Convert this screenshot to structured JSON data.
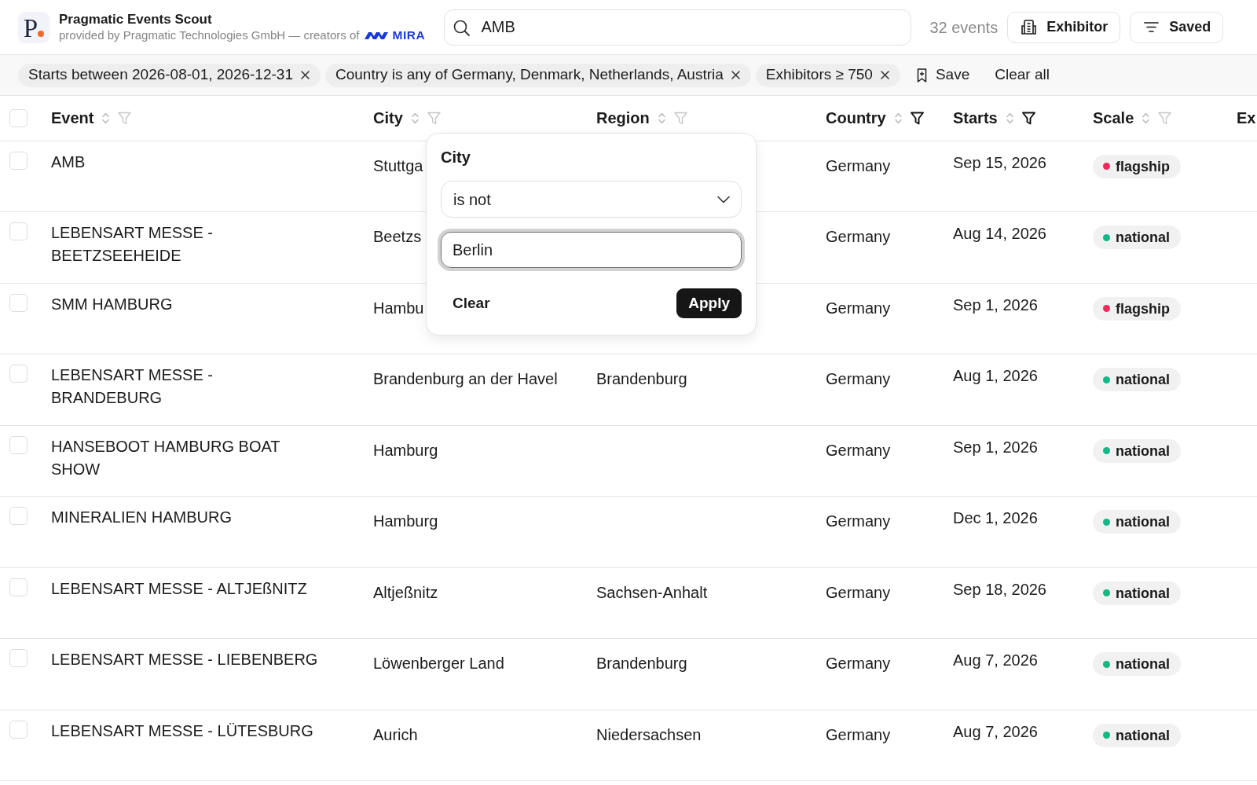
{
  "header": {
    "logo_letter": "P",
    "title": "Pragmatic Events Scout",
    "subtitle": "provided by Pragmatic Technologies GmbH — creators of",
    "brand": "MIRA",
    "search": {
      "value": "AMB"
    },
    "count": "32 events",
    "buttons": [
      {
        "label": "Exhibitor",
        "kind": "exhibitor"
      },
      {
        "label": "Saved",
        "kind": "saved"
      }
    ]
  },
  "filters": {
    "chips": [
      {
        "label": "Starts between 2026-08-01, 2026-12-31"
      },
      {
        "label": "Country is any of Germany, Denmark, Netherlands, Austria"
      },
      {
        "label": "Exhibitors ≥ 750"
      }
    ],
    "save": "Save",
    "clear_all": "Clear all"
  },
  "table": {
    "all_selected": false,
    "columns": [
      {
        "label": "Event",
        "filtered": false
      },
      {
        "label": "City",
        "filtered": false
      },
      {
        "label": "Region",
        "filtered": false
      },
      {
        "label": "Country",
        "filtered": true
      },
      {
        "label": "Starts",
        "filtered": true
      },
      {
        "label": "Scale",
        "filtered": false
      }
    ],
    "cut_column": {
      "label": "Ex"
    },
    "rows": [
      {
        "selected": false,
        "event": "AMB",
        "city": "Stuttga",
        "country": "Germany",
        "starts": "Sep 15, 2026",
        "scale": {
          "label": "flagship",
          "color": "#f2295b"
        }
      },
      {
        "selected": false,
        "event": "LEBENSART MESSE - BEETZSEEHEIDE",
        "city": "Beetzs",
        "country": "Germany",
        "starts": "Aug 14, 2026",
        "scale": {
          "label": "national",
          "color": "#12b886"
        }
      },
      {
        "selected": false,
        "event": "SMM HAMBURG",
        "city": "Hambu",
        "country": "Germany",
        "starts": "Sep 1, 2026",
        "scale": {
          "label": "flagship",
          "color": "#f2295b"
        }
      },
      {
        "selected": false,
        "event": "LEBENSART MESSE - BRANDEBURG",
        "city": "Brandenburg an der Havel",
        "region": "Brandenburg",
        "country": "Germany",
        "starts": "Aug 1, 2026",
        "scale": {
          "label": "national",
          "color": "#12b886"
        }
      },
      {
        "selected": false,
        "event": "HANSEBOOT HAMBURG BOAT SHOW",
        "city": "Hamburg",
        "country": "Germany",
        "starts": "Sep 1, 2026",
        "scale": {
          "label": "national",
          "color": "#12b886"
        }
      },
      {
        "selected": false,
        "event": "MINERALIEN HAMBURG",
        "city": "Hamburg",
        "country": "Germany",
        "starts": "Dec 1, 2026",
        "scale": {
          "label": "national",
          "color": "#12b886"
        }
      },
      {
        "selected": false,
        "event": "LEBENSART MESSE - ALTJEßNITZ",
        "city": "Altjeßnitz",
        "region": "Sachsen-Anhalt",
        "country": "Germany",
        "starts": "Sep 18, 2026",
        "scale": {
          "label": "national",
          "color": "#12b886"
        }
      },
      {
        "selected": false,
        "event": "LEBENSART MESSE - LIEBENBERG",
        "city": "Löwenberger Land",
        "region": "Brandenburg",
        "country": "Germany",
        "starts": "Aug 7, 2026",
        "scale": {
          "label": "national",
          "color": "#12b886"
        }
      },
      {
        "selected": false,
        "event": "LEBENSART MESSE - LÜTESBURG",
        "city": "Aurich",
        "region": "Niedersachsen",
        "country": "Germany",
        "starts": "Aug 7, 2026",
        "scale": {
          "label": "national",
          "color": "#12b886"
        }
      }
    ]
  },
  "filter_popover": {
    "title": "City",
    "operator": "is not",
    "value": "Berlin",
    "clear": "Clear",
    "apply": "Apply"
  }
}
